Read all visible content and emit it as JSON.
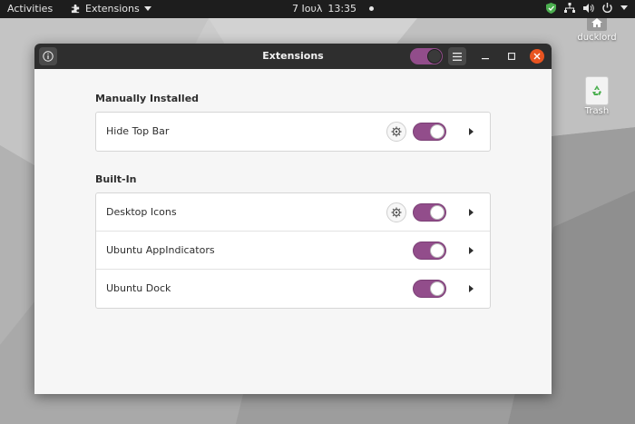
{
  "topbar": {
    "activities": "Activities",
    "app_menu": "Extensions",
    "date": "7 Ιουλ",
    "time": "13:35"
  },
  "desktop": {
    "home_label": "ducklord",
    "trash_label": "Trash"
  },
  "window": {
    "title": "Extensions",
    "sections": [
      {
        "title": "Manually Installed",
        "items": [
          {
            "name": "Hide Top Bar",
            "has_settings": true,
            "enabled": true
          }
        ]
      },
      {
        "title": "Built-In",
        "items": [
          {
            "name": "Desktop Icons",
            "has_settings": true,
            "enabled": true
          },
          {
            "name": "Ubuntu AppIndicators",
            "has_settings": false,
            "enabled": true
          },
          {
            "name": "Ubuntu Dock",
            "has_settings": false,
            "enabled": true
          }
        ]
      }
    ]
  },
  "colors": {
    "accent": "#924d8b",
    "close": "#e95420",
    "topbar": "#1d1d1d"
  }
}
